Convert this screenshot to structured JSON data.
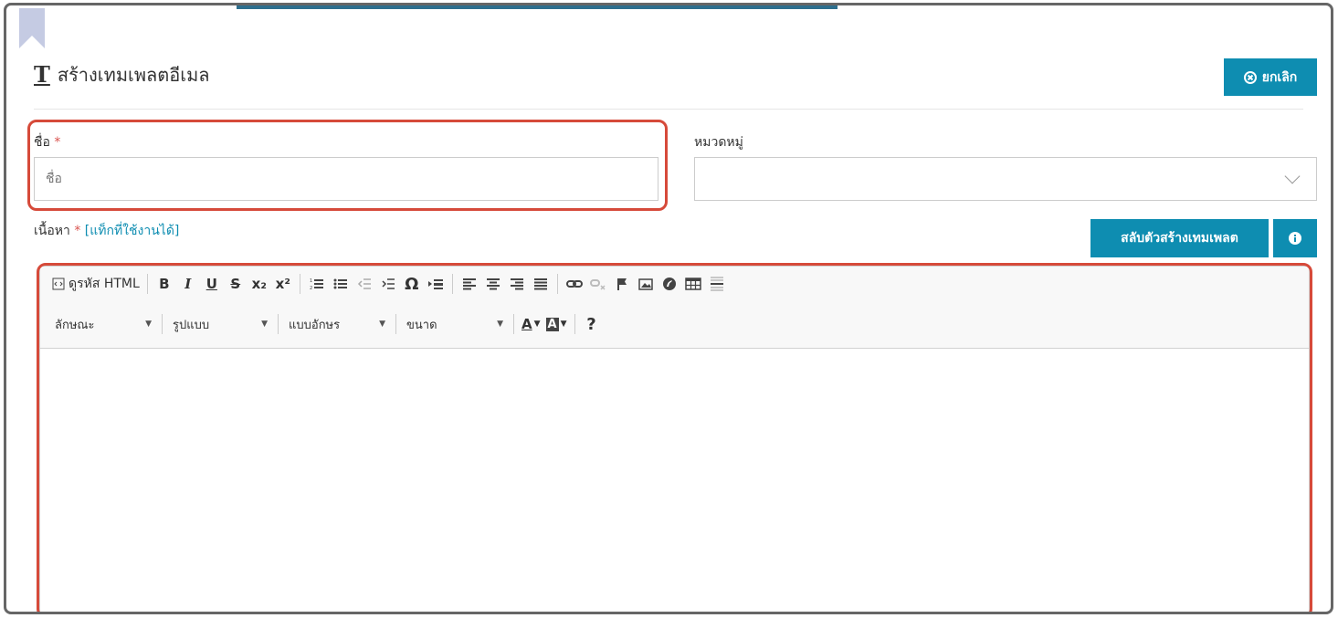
{
  "page": {
    "title_icon": "T",
    "title": "สร้างเทมเพลตอีเมล",
    "cancel_label": "ยกเลิก"
  },
  "form": {
    "name_label": "ชื่อ",
    "required_mark": "*",
    "name_placeholder": "ชื่อ",
    "name_value": "",
    "category_label": "หมวดหมู่",
    "category_value": "",
    "content_label": "เนื้อหา",
    "tags_link": "[แท็กที่ใช้งานได้]"
  },
  "buttons": {
    "swap_builder": "สลับตัวสร้างเทมเพลต",
    "info_icon": "info-icon"
  },
  "toolbar": {
    "source_label": "ดูรหัส HTML",
    "bold": "B",
    "italic": "I",
    "underline": "U",
    "strike": "S",
    "subscript": "x₂",
    "superscript": "x²",
    "special_char": "Ω",
    "text_color": "A",
    "bg_color": "A",
    "help": "?",
    "style_dd": "ลักษณะ",
    "format_dd": "รูปแบบ",
    "font_dd": "แบบอักษร",
    "size_dd": "ขนาด"
  },
  "colors": {
    "accent": "#0e8db1",
    "highlight": "#d64a3a",
    "frame": "#666666"
  }
}
